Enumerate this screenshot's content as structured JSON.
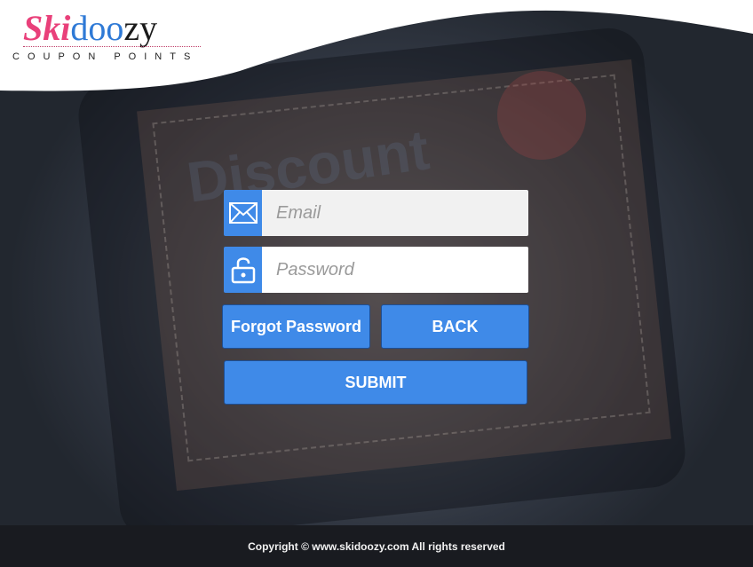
{
  "brand": {
    "logo_part1": "Ski",
    "logo_part2": "doo",
    "logo_part3": "zy",
    "tagline": "COUPON POINTS"
  },
  "background": {
    "word": "Discount"
  },
  "form": {
    "email_placeholder": "Email",
    "email_value": "",
    "password_placeholder": "Password",
    "password_value": "",
    "forgot_label": "Forgot Password",
    "back_label": "BACK",
    "submit_label": "SUBMIT"
  },
  "icons": {
    "email": "envelope-icon",
    "password": "unlock-icon"
  },
  "colors": {
    "accent": "#3f8ae8",
    "logo_pink": "#e9407a",
    "logo_blue": "#2f7ad6",
    "footer_bg": "#191b20"
  },
  "footer": {
    "text": "Copyright © www.skidoozy.com All rights reserved"
  }
}
